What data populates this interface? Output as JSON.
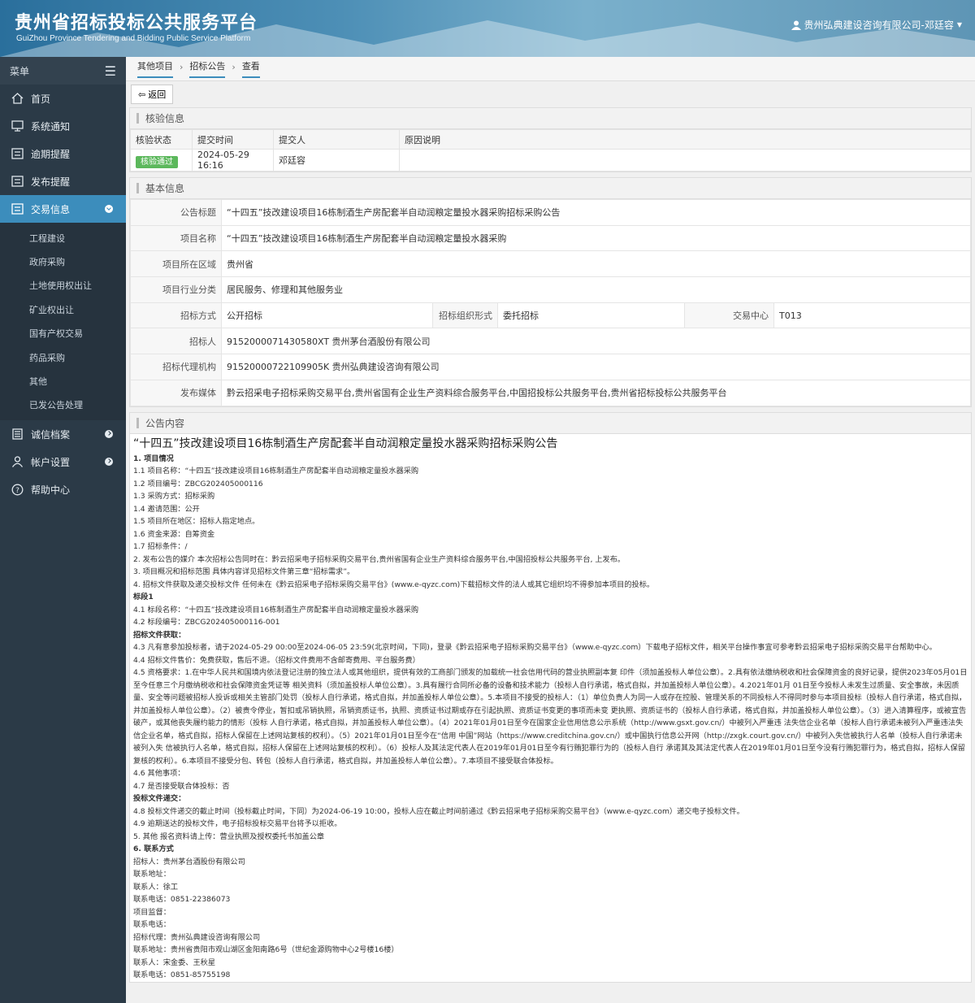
{
  "header": {
    "title": "贵州省招标投标公共服务平台",
    "subtitle": "GuiZhou Province Tendering and Bidding Public Service Platform",
    "user": "贵州弘典建设咨询有限公司-邓廷容"
  },
  "sidebar": {
    "menu_label": "菜单",
    "items": [
      {
        "label": "首页"
      },
      {
        "label": "系统通知"
      },
      {
        "label": "逾期提醒"
      },
      {
        "label": "发布提醒"
      },
      {
        "label": "交易信息"
      }
    ],
    "sub_items": [
      "工程建设",
      "政府采购",
      "土地使用权出让",
      "矿业权出让",
      "国有产权交易",
      "药品采购",
      "其他",
      "已发公告处理"
    ],
    "bottom_items": [
      {
        "label": "诚信档案"
      },
      {
        "label": "帐户设置"
      },
      {
        "label": "帮助中心"
      }
    ]
  },
  "breadcrumb": [
    "其他项目",
    "招标公告",
    "查看"
  ],
  "toolbar": {
    "back_label": "返回"
  },
  "verify": {
    "panel_title": "核验信息",
    "headers": [
      "核验状态",
      "提交时间",
      "提交人",
      "原因说明"
    ],
    "status": "核验通过",
    "submit_time": "2024-05-29 16:16",
    "submitter": "邓廷容",
    "reason": ""
  },
  "basic": {
    "panel_title": "基本信息",
    "rows": [
      {
        "label": "公告标题",
        "value": "“十四五”技改建设项目16栋制酒生产房配套半自动润粮定量投水器采购招标采购公告"
      },
      {
        "label": "项目名称",
        "value": "“十四五”技改建设项目16栋制酒生产房配套半自动润粮定量投水器采购"
      },
      {
        "label": "项目所在区域",
        "value": "贵州省"
      },
      {
        "label": "项目行业分类",
        "value": "居民服务、修理和其他服务业"
      }
    ],
    "method_label": "招标方式",
    "method": "公开招标",
    "org_label": "招标组织形式",
    "org": "委托招标",
    "center_label": "交易中心",
    "center": "T013",
    "rows2": [
      {
        "label": "招标人",
        "value": "9152000071430580XT 贵州茅台酒股份有限公司"
      },
      {
        "label": "招标代理机构",
        "value": "91520000722109905K 贵州弘典建设咨询有限公司"
      },
      {
        "label": "发布媒体",
        "value": "黔云招采电子招标采购交易平台,贵州省国有企业生产资料综合服务平台,中国招投标公共服务平台,贵州省招标投标公共服务平台"
      }
    ]
  },
  "announcement": {
    "panel_title": "公告内容",
    "title": "“十四五”技改建设项目16栋制酒生产房配套半自动润粮定量投水器采购招标采购公告",
    "lines": [
      {
        "t": "1. 项目情况",
        "b": true
      },
      {
        "t": "1.1 项目名称：“十四五”技改建设项目16栋制酒生产房配套半自动润粮定量投水器采购"
      },
      {
        "t": "1.2 项目编号：ZBCG202405000116"
      },
      {
        "t": "1.3 采购方式：招标采购"
      },
      {
        "t": "1.4 邀请范围：公开"
      },
      {
        "t": "1.5 项目所在地区：招标人指定地点。"
      },
      {
        "t": "1.6 资金来源：自筹资金"
      },
      {
        "t": "1.7 招标条件：/"
      },
      {
        "t": "2. 发布公告的媒介 本次招标公告同时在：黔云招采电子招标采购交易平台,贵州省国有企业生产资料综合服务平台,中国招投标公共服务平台, 上发布。"
      },
      {
        "t": "3. 项目概况和招标范围 具体内容详见招标文件第三章“招标需求”。"
      },
      {
        "t": "4. 招标文件获取及递交投标文件 任何未在《黔云招采电子招标采购交易平台》(www.e-qyzc.com)下载招标文件的法人或其它组织均不得参加本项目的投标。"
      },
      {
        "t": "标段1",
        "b": true
      },
      {
        "t": "4.1 标段名称：“十四五”技改建设项目16栋制酒生产房配套半自动润粮定量投水器采购"
      },
      {
        "t": "4.2 标段编号：ZBCG202405000116-001"
      },
      {
        "t": "招标文件获取：",
        "b": true
      },
      {
        "t": "4.3 凡有意参加投标者，请于2024-05-29 00:00至2024-06-05 23:59(北京时间，下同)，登录《黔云招采电子招标采购交易平台》（www.e-qyzc.com）下载电子招标文件，相关平台操作事宜可参考黔云招采电子招标采购交易平台帮助中心。"
      },
      {
        "t": "4.4 招标文件售价：免费获取，售后不退。（招标文件费用不含邮寄费用、平台服务费）"
      },
      {
        "t": "4.5 资格要求：1.在中华人民共和国境内依法登记注册的独立法人或其他组织，提供有效的工商部门颁发的加载统一社会信用代码的营业执照副本复 印件（须加盖投标人单位公章）。2.具有依法缴纳税收和社会保障资金的良好记录，提供2023年05月01日至今任意三个月缴纳税收和社会保障资金凭证等 相关资料（须加盖投标人单位公章）。3.具有履行合同所必备的设备和技术能力（投标人自行承诺，格式自拟，并加盖投标人单位公章）。4.2021年01月 01日至今投标人未发生过质量、安全事故，未因质量、安全等问题被招标人投诉或相关主管部门处罚（投标人自行承诺，格式自拟，并加盖投标人单位公章）。5.本项目不接受的投标人：（1）单位负责人为同一人或存在控股、管理关系的不同投标人不得同时参与本项目投标（投标人自行承诺，格式自拟，并加盖投标人单位公章）。（2）被责令停业，暂扣或吊销执照，吊销资质证书，执照、资质证书过期或存在引起执照、资质证书变更的事项而未变 更执照、资质证书的（投标人自行承诺，格式自拟，并加盖投标人单位公章）。（3）进入清算程序，或被宣告破产，或其他丧失履约能力的情形（投标 人自行承诺，格式自拟，并加盖投标人单位公章）。（4）2021年01月01日至今在国家企业信用信息公示系统（http://www.gsxt.gov.cn/）中被列入严重违 法失信企业名单（投标人自行承诺未被列入严重违法失信企业名单，格式自拟，招标人保留在上述网站复核的权利）。（5）2021年01月01日至今在“信用 中国”网站（https://www.creditchina.gov.cn/）或中国执行信息公开网（http://zxgk.court.gov.cn/）中被列入失信被执行人名单（投标人自行承诺未被列入失 信被执行人名单，格式自拟，招标人保留在上述网站复核的权利）。（6）投标人及其法定代表人在2019年01月01日至今有行贿犯罪行为的（投标人自行 承诺其及其法定代表人在2019年01月01日至今没有行贿犯罪行为，格式自拟，招标人保留复核的权利）。6.本项目不接受分包、转包（投标人自行承诺，格式自拟，并加盖投标人单位公章）。7.本项目不接受联合体投标。",
        "wrap": true
      },
      {
        "t": "4.6 其他事项："
      },
      {
        "t": "4.7 是否接受联合体投标：否"
      },
      {
        "t": "投标文件递交：",
        "b": true
      },
      {
        "t": "4.8 投标文件递交的截止时间（投标截止时间，下同）为2024-06-19 10:00，投标人应在截止时间前通过《黔云招采电子招标采购交易平台》（www.e-qyzc.com）递交电子投标文件。"
      },
      {
        "t": "4.9 逾期送达的投标文件，电子招标投标交易平台将予以拒收。"
      },
      {
        "t": "5. 其他 报名资料请上传：营业执照及授权委托书加盖公章",
        "b": false
      },
      {
        "t": "6. 联系方式",
        "b": true
      },
      {
        "t": "招标人：贵州茅台酒股份有限公司"
      },
      {
        "t": "联系地址："
      },
      {
        "t": "联系人：徐工"
      },
      {
        "t": "联系电话：0851-22386073"
      },
      {
        "t": "项目监督："
      },
      {
        "t": "联系电话："
      },
      {
        "t": "招标代理：贵州弘典建设咨询有限公司"
      },
      {
        "t": "联系地址：贵州省贵阳市观山湖区金阳南路6号（世纪金源购物中心2号楼16楼）"
      },
      {
        "t": "联系人：宋金委、王秋星"
      },
      {
        "t": "联系电话：0851-85755198"
      }
    ]
  }
}
